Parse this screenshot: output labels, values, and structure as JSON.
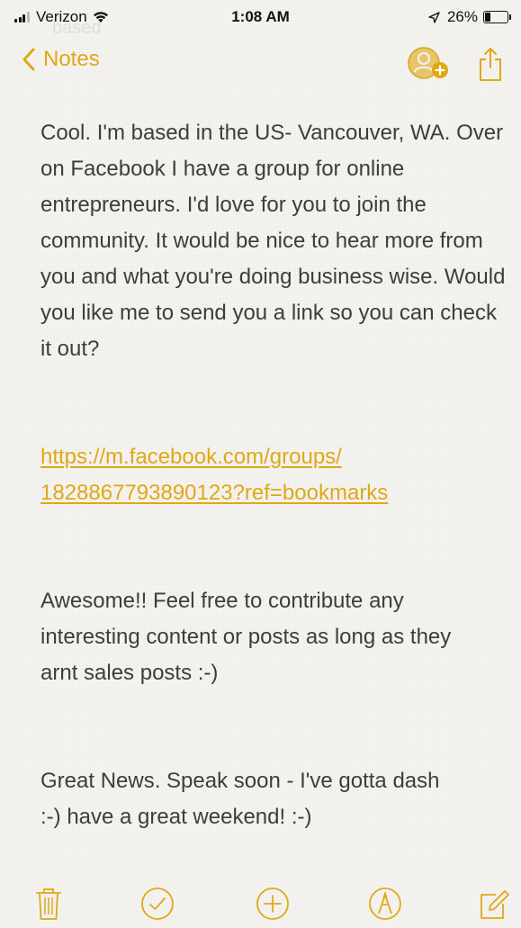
{
  "status_bar": {
    "carrier": "Verizon",
    "time": "1:08 AM",
    "battery_percent": "26%",
    "battery_level": 0.26
  },
  "ghost": "based",
  "nav": {
    "back_label": "Notes",
    "add_people_icon": "person-add-icon",
    "share_icon": "share-icon"
  },
  "note": {
    "paragraph_1": "Cool. I'm based in the US- Vancouver, WA. Over on Facebook I have a group for online entrepreneurs. I'd love for you to join the community. It would be nice to hear more from you and what you're doing business wise. Would you like me to send you a link so you can check it out?",
    "link_line_1": "https://m.facebook.com/groups/",
    "link_line_2": "1828867793890123?ref=bookmarks",
    "paragraph_2": "Awesome!! Feel free to contribute any interesting content or posts as long as they arnt sales posts :-)",
    "paragraph_3": "Great News. Speak soon - I've gotta dash :-) have a great weekend! :-)"
  },
  "toolbar": {
    "icons": [
      "trash-icon",
      "checklist-icon",
      "add-icon",
      "markup-icon",
      "compose-icon"
    ]
  },
  "colors": {
    "accent": "#e0a815",
    "background": "#f4f3f0",
    "text": "#3d3d3d"
  }
}
